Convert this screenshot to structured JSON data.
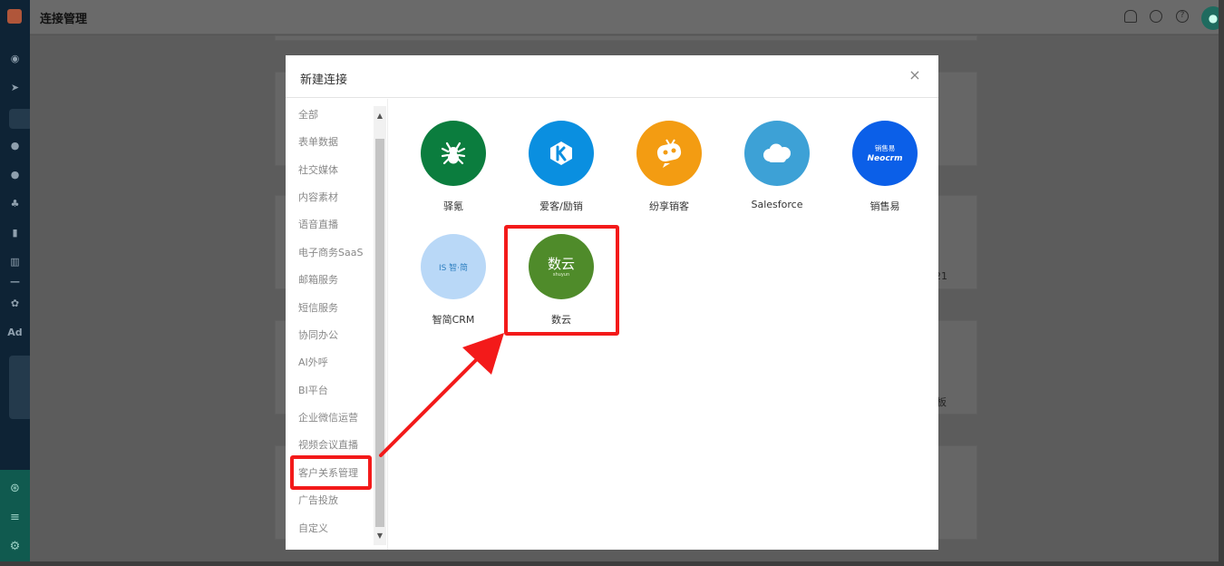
{
  "page": {
    "title": "连接管理"
  },
  "background": {
    "fragments": [
      "21",
      "板"
    ]
  },
  "modal": {
    "title": "新建连接",
    "close_label": "×",
    "categories": [
      {
        "label": "全部"
      },
      {
        "label": "表单数据"
      },
      {
        "label": "社交媒体"
      },
      {
        "label": "内容素材"
      },
      {
        "label": "语音直播"
      },
      {
        "label": "电子商务SaaS"
      },
      {
        "label": "邮箱服务"
      },
      {
        "label": "短信服务"
      },
      {
        "label": "协同办公"
      },
      {
        "label": "AI外呼"
      },
      {
        "label": "BI平台"
      },
      {
        "label": "企业微信运营"
      },
      {
        "label": "视频会议直播"
      },
      {
        "label": "客户关系管理",
        "selected": true
      },
      {
        "label": "广告投放"
      },
      {
        "label": "自定义"
      }
    ],
    "connectors": [
      {
        "name": "驿氪",
        "logo_text": "",
        "color": "#0b7d3e",
        "icon": "spider-icon"
      },
      {
        "name": "爱客/励销",
        "logo_text": "K",
        "color": "#0a8fe0",
        "icon": "k-logo-icon"
      },
      {
        "name": "纷享销客",
        "logo_text": "",
        "color": "#f39c12",
        "icon": "robot-icon"
      },
      {
        "name": "Salesforce",
        "logo_text": "",
        "color": "#3da1d6",
        "icon": "cloud-icon"
      },
      {
        "name": "销售易",
        "logo_text": "销售易 Neocrm",
        "color": "#0b5fe8",
        "icon": "neocrm-logo-icon"
      },
      {
        "name": "智简CRM",
        "logo_text": "IS 智·简",
        "color": "#b9d8f7",
        "icon": "zhijian-logo-icon"
      },
      {
        "name": "数云",
        "logo_text": "数云",
        "logo_subtext": "shuyun",
        "color": "#4f8b2a",
        "icon": "shuyun-logo-icon"
      }
    ]
  },
  "colors": {
    "highlight": "#f31a1a",
    "sidebar": "#0e2335"
  }
}
